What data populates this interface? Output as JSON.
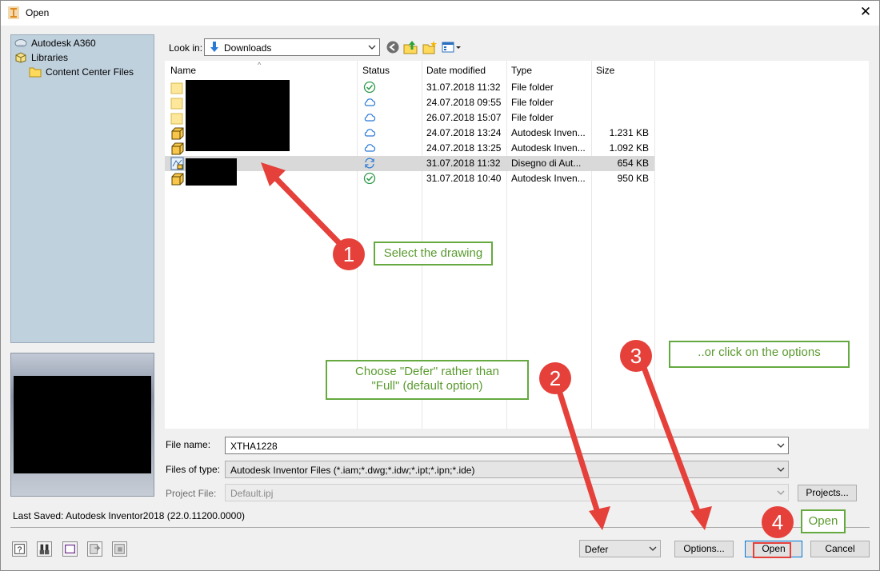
{
  "window": {
    "title": "Open"
  },
  "locations": [
    {
      "label": "Autodesk A360",
      "icon": "cloud-drive-icon"
    },
    {
      "label": "Libraries",
      "icon": "libraries-icon"
    },
    {
      "label": "Content Center Files",
      "icon": "folder-icon"
    }
  ],
  "toolbar": {
    "lookin_label": "Look in:",
    "lookin_value": "Downloads",
    "icons": [
      "back-icon",
      "up-folder-icon",
      "new-folder-icon",
      "view-menu-icon"
    ]
  },
  "columns": [
    "Name",
    "Status",
    "Date modified",
    "Type",
    "Size"
  ],
  "files": [
    {
      "name": "",
      "icon": "folder-icon",
      "status": "synced",
      "date": "31.07.2018 11:32",
      "type": "File folder",
      "size": ""
    },
    {
      "name": "",
      "icon": "folder-icon",
      "status": "cloud",
      "date": "24.07.2018 09:55",
      "type": "File folder",
      "size": ""
    },
    {
      "name": "",
      "icon": "folder-icon",
      "status": "cloud",
      "date": "26.07.2018 15:07",
      "type": "File folder",
      "size": ""
    },
    {
      "name": "",
      "icon": "inventor-part-icon",
      "status": "cloud",
      "date": "24.07.2018 13:24",
      "type": "Autodesk Inven...",
      "size": "1.231 KB"
    },
    {
      "name": "",
      "icon": "inventor-part-icon",
      "status": "cloud",
      "date": "24.07.2018 13:25",
      "type": "Autodesk Inven...",
      "size": "1.092 KB"
    },
    {
      "name": "",
      "icon": "drawing-icon",
      "status": "syncing",
      "date": "31.07.2018 11:32",
      "type": "Disegno di Aut...",
      "size": "654 KB",
      "selected": true
    },
    {
      "name": "",
      "icon": "inventor-part-icon",
      "status": "synced",
      "date": "31.07.2018 10:40",
      "type": "Autodesk Inven...",
      "size": "950 KB"
    }
  ],
  "form": {
    "filename_label": "File name:",
    "filename_value": "XTHA1228",
    "filetype_label": "Files of type:",
    "filetype_value": "Autodesk Inventor Files (*.iam;*.dwg;*.idw;*.ipt;*.ipn;*.ide)",
    "project_label": "Project File:",
    "project_value": "Default.ipj",
    "projects_button": "Projects..."
  },
  "footer": {
    "last_saved": "Last Saved: Autodesk Inventor2018 (22.0.11200.0000)",
    "defer_value": "Defer",
    "options_button": "Options...",
    "open_button": "Open",
    "cancel_button": "Cancel",
    "bottom_icons": [
      "help-icon",
      "find-icon",
      "frame-icon",
      "forward-icon",
      "export-icon"
    ]
  },
  "annotations": [
    {
      "number": "1",
      "text": "Select the drawing"
    },
    {
      "number": "2",
      "text": "Choose \"Defer\" rather than \"Full\" (default option)"
    },
    {
      "number": "3",
      "text": "..or click on the options"
    },
    {
      "number": "4",
      "text": "Open"
    }
  ],
  "colors": {
    "annotation_red": "#e5403a",
    "annotation_green": "#65a940",
    "selection": "#d9d9d9",
    "panel": "#c0d1de"
  }
}
